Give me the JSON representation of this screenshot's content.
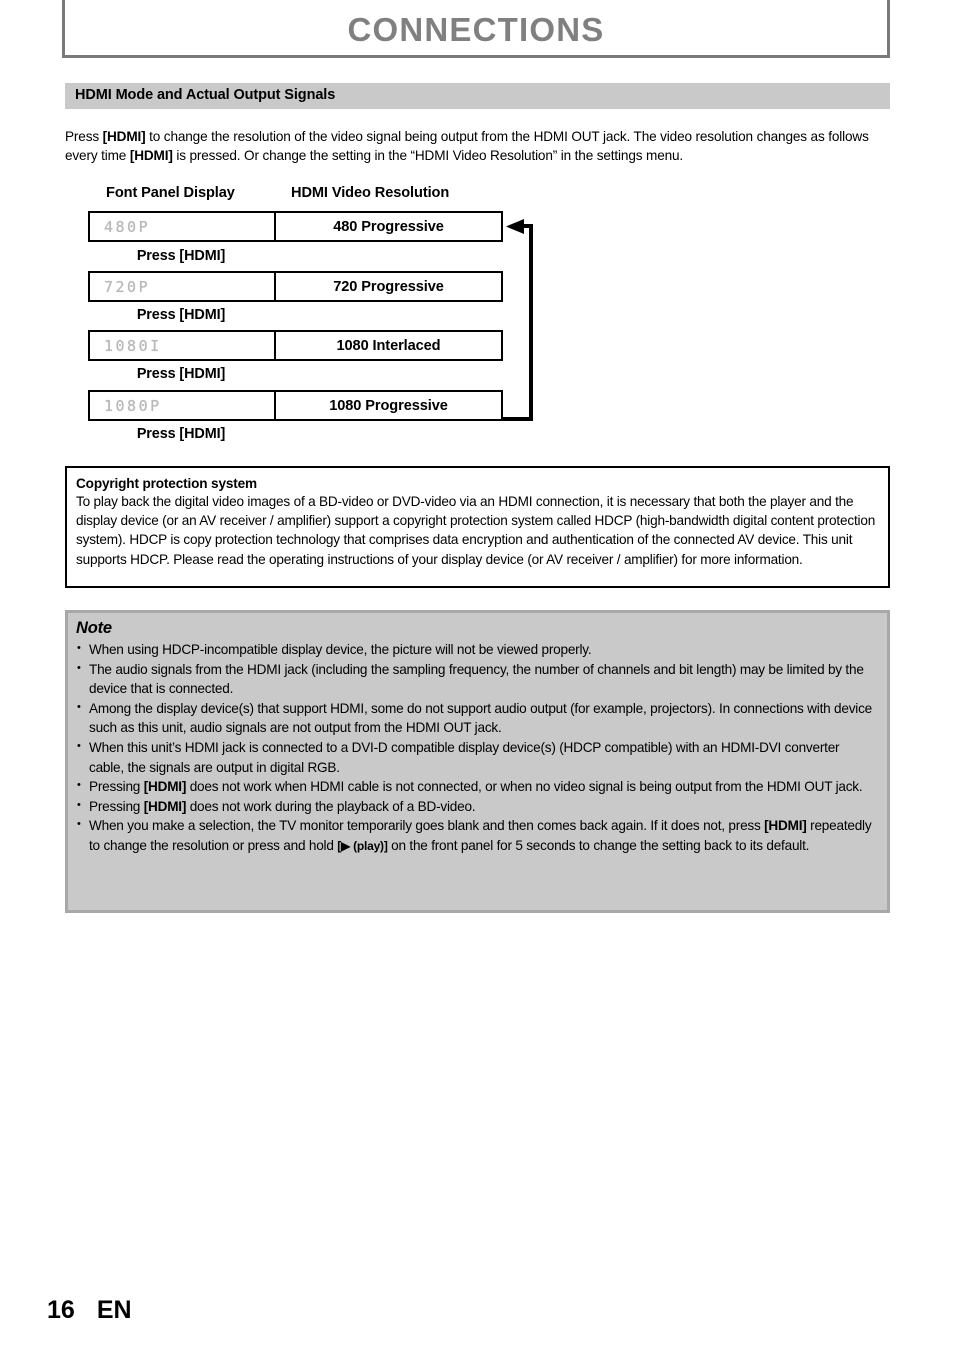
{
  "page": {
    "title": "CONNECTIONS",
    "footer": {
      "page_number": "16",
      "language": "EN"
    }
  },
  "section": {
    "heading": "HDMI Mode and Actual Output Signals",
    "intro_parts": {
      "p1": "Press ",
      "b1": "[HDMI]",
      "p2": " to change the resolution of the video signal being output from the HDMI OUT jack. The video resolution changes as follows every time ",
      "b2": "[HDMI]",
      "p3": " is pressed. Or change the setting in the “HDMI Video Resolution” in the settings menu."
    }
  },
  "diagram": {
    "column_headers": {
      "left": "Font Panel Display",
      "right": "HDMI Video Resolution"
    },
    "press_label": "Press [HDMI]",
    "rows": [
      {
        "lcd": "480P",
        "resolution": "480 Progressive"
      },
      {
        "lcd": "720P",
        "resolution": "720 Progressive"
      },
      {
        "lcd": "1080I",
        "resolution": "1080 Interlaced"
      },
      {
        "lcd": "1080P",
        "resolution": "1080 Progressive"
      }
    ]
  },
  "copyright": {
    "title": "Copyright protection system",
    "body": "To play back the digital video images of a BD-video or DVD-video via an HDMI connection, it is necessary that both the player and the display device (or an AV receiver / amplifier) support a copyright protection system called HDCP (high-bandwidth digital content protection system). HDCP is copy protection technology that comprises data encryption and authentication of the connected AV device. This unit supports HDCP. Please read the operating instructions of your display device (or AV receiver / amplifier) for more information."
  },
  "note": {
    "title": "Note",
    "items": [
      {
        "t1": "When using HDCP-incompatible display device, the picture will not be viewed properly."
      },
      {
        "t1": "The audio signals from the HDMI jack (including the sampling frequency, the number of channels and bit length) may be limited by the device that is connected."
      },
      {
        "t1": "Among the display device(s) that support HDMI, some do not support audio output (for example, projectors). In connections with device such as this unit, audio signals are not output from the HDMI OUT jack."
      },
      {
        "t1": "When this unit’s HDMI jack is connected to a DVI-D compatible display device(s) (HDCP compatible) with an HDMI-DVI  converter cable, the signals are output in digital RGB."
      },
      {
        "t1": "Pressing ",
        "b1": "[HDMI]",
        "t2": " does not work when HDMI cable is not connected, or when no video signal is being output from the HDMI OUT jack."
      },
      {
        "t1": "Pressing ",
        "b1": "[HDMI]",
        "t2": " does not work during the playback of a BD-video."
      },
      {
        "t1": "When you make a selection, the TV monitor temporarily goes blank and then comes back again. If it does not, press ",
        "b1": "[HDMI]",
        "t2": " repeatedly to change the resolution or press and hold ",
        "b2": "[▶ (play)]",
        "t3": " on the front panel for 5 seconds to change the setting back to its default."
      }
    ]
  },
  "colors": {
    "band_gray": "#c9c9c9",
    "title_gray": "#808080",
    "note_border": "#a8a8a8",
    "lcd_gray": "#b9b9b9"
  }
}
